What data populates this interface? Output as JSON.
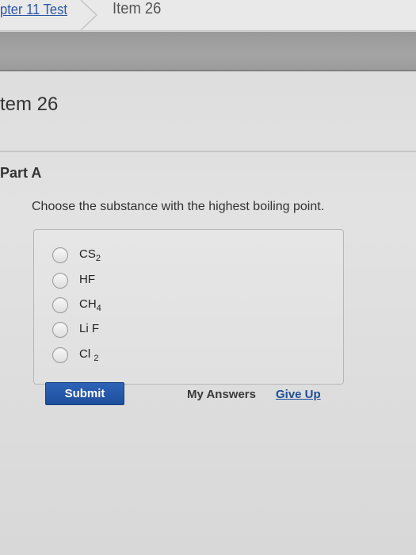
{
  "breadcrumb": {
    "parent_link": "pter 11 Test",
    "current": "Item 26"
  },
  "item": {
    "title": "tem 26"
  },
  "part": {
    "label": "Part A",
    "question": "Choose the substance with the highest boiling point."
  },
  "options": [
    {
      "base": "CS",
      "sub": "2",
      "selected": false
    },
    {
      "base": "HF",
      "sub": "",
      "selected": false
    },
    {
      "base": "CH",
      "sub": "4",
      "selected": false
    },
    {
      "base": "Li F",
      "sub": "",
      "selected": false
    },
    {
      "base": "Cl ",
      "sub": "2",
      "selected": false
    }
  ],
  "actions": {
    "submit_label": "Submit",
    "my_answers_label": "My Answers",
    "give_up_label": "Give Up"
  },
  "colors": {
    "link": "#2b56a8",
    "submit_bg": "#2d63b6",
    "give_up": "#1e4e9a"
  }
}
